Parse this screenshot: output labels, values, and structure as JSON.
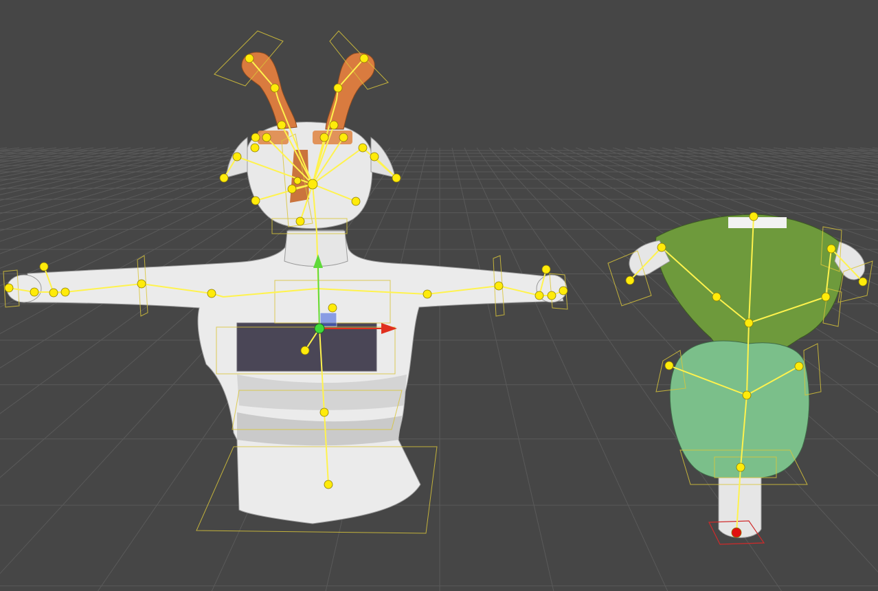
{
  "scene": {
    "background_color": "#464646",
    "grid_color": "#5a5a5a",
    "horizon_color": "#4a4a4a"
  },
  "models": [
    {
      "id": "torso-rig",
      "mesh_color": "#ebebeb",
      "accent_color": "#d97b3f",
      "chest_panel_color": "#4a4656",
      "bone_color": "#fff34d",
      "joint_color": "#ffeb0a",
      "selected": false
    },
    {
      "id": "vase-rig",
      "mesh_color": "#ebebeb",
      "upper_color": "#6e9a3c",
      "lower_color": "#7bbf8a",
      "bone_color": "#fff34d",
      "joint_color": "#ffeb0a",
      "root_joint_color": "#e01010",
      "selected": false
    }
  ],
  "transform_gizmo": {
    "x_axis_color": "#e0301e",
    "y_axis_color": "#5fd93a",
    "z_axis_color": "#3a5de0",
    "center_color": "#3fd93a"
  }
}
